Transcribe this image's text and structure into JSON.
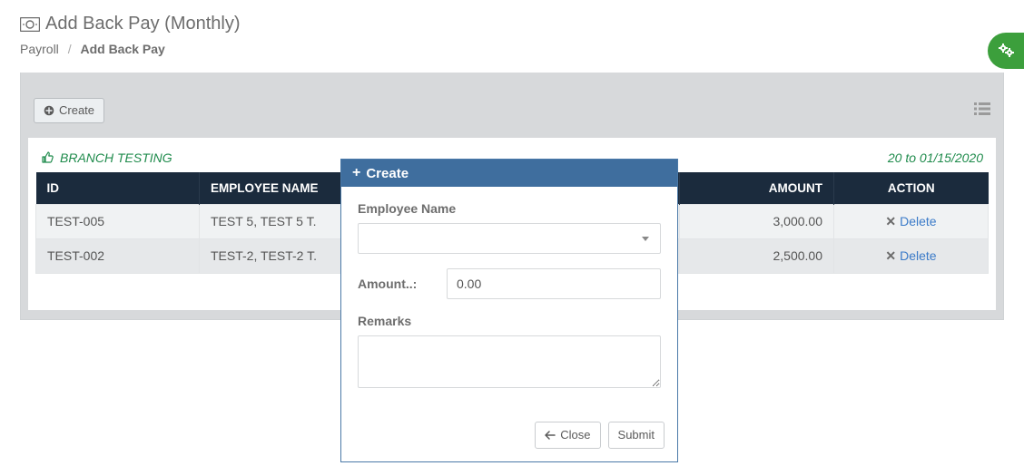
{
  "header": {
    "title": "Add Back Pay (Monthly)",
    "breadcrumb_root": "Payroll",
    "breadcrumb_sep": "/",
    "breadcrumb_current": "Add Back Pay"
  },
  "toolbar": {
    "create_label": "Create"
  },
  "meta": {
    "branch": "BRANCH TESTING",
    "period_suffix": "20 to 01/15/2020"
  },
  "table": {
    "headers": {
      "id": "ID",
      "name": "EMPLOYEE NAME",
      "amount": "AMOUNT",
      "action": "ACTION"
    },
    "rows": [
      {
        "id": "TEST-005",
        "name": "TEST 5, TEST 5 T.",
        "amount": "3,000.00",
        "action": "Delete"
      },
      {
        "id": "TEST-002",
        "name": "TEST-2, TEST-2 T.",
        "amount": "2,500.00",
        "action": "Delete"
      }
    ]
  },
  "modal": {
    "title": "Create",
    "labels": {
      "employee": "Employee Name",
      "amount": "Amount..:",
      "remarks": "Remarks"
    },
    "values": {
      "amount": "0.00",
      "remarks": ""
    },
    "buttons": {
      "close": "Close",
      "submit": "Submit"
    }
  }
}
